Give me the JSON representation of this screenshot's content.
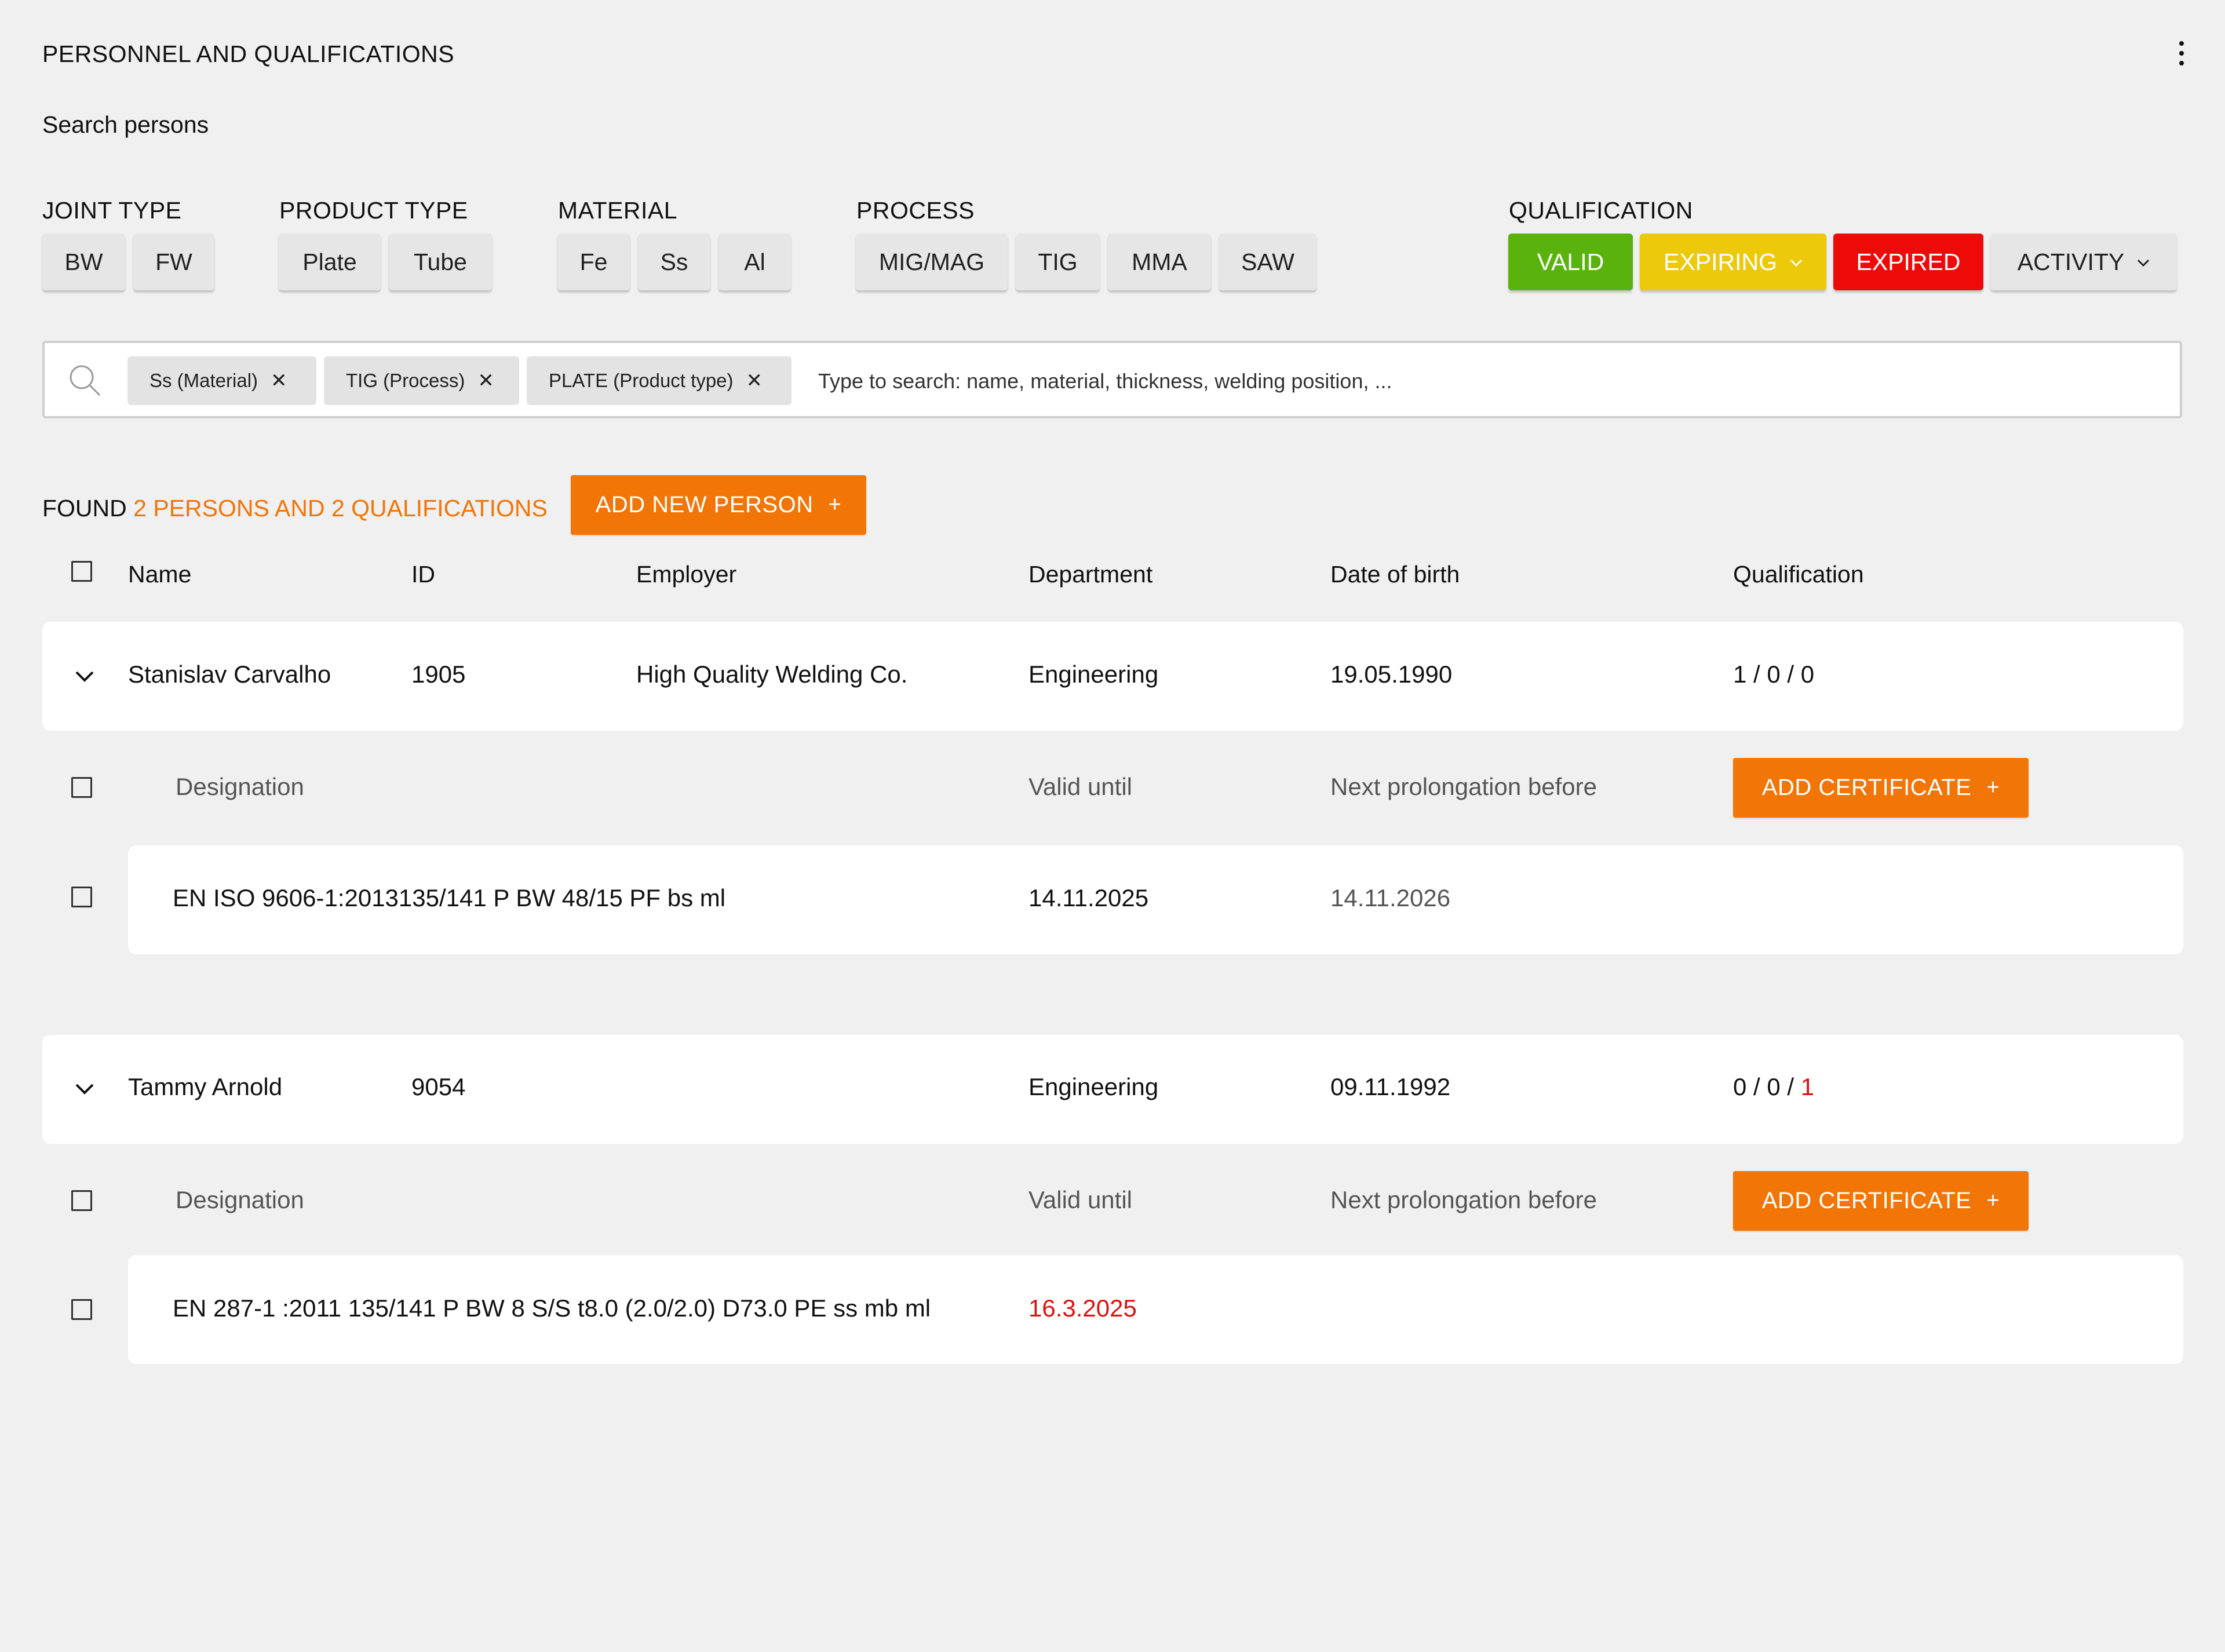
{
  "header": {
    "title": "PERSONNEL AND QUALIFICATIONS",
    "subtitle": "Search persons"
  },
  "filters": {
    "joint_type": {
      "label": "JOINT TYPE",
      "options": [
        "BW",
        "FW"
      ]
    },
    "product_type": {
      "label": "PRODUCT TYPE",
      "options": [
        "Plate",
        "Tube"
      ]
    },
    "material": {
      "label": "MATERIAL",
      "options": [
        "Fe",
        "Ss",
        "Al"
      ]
    },
    "process": {
      "label": "PROCESS",
      "options": [
        "MIG/MAG",
        "TIG",
        "MMA",
        "SAW"
      ]
    },
    "qualification": {
      "label": "QUALIFICATION",
      "valid": "VALID",
      "expiring": "EXPIRING",
      "expired": "EXPIRED",
      "activity": "ACTIVITY"
    }
  },
  "search": {
    "tags": [
      "Ss (Material)",
      "TIG (Process)",
      "PLATE (Product type)"
    ],
    "placeholder": "Type to search: name, material, thickness, welding position, ..."
  },
  "results": {
    "found_label": "FOUND",
    "found_summary": "2 PERSONS AND 2 QUALIFICATIONS",
    "add_person_label": "ADD NEW PERSON"
  },
  "columns": {
    "name": "Name",
    "id": "ID",
    "employer": "Employer",
    "department": "Department",
    "dob": "Date of birth",
    "qualification": "Qualification"
  },
  "cert_columns": {
    "designation": "Designation",
    "valid_until": "Valid until",
    "next_prolongation": "Next prolongation before",
    "add_certificate": "ADD CERTIFICATE"
  },
  "persons": [
    {
      "name": "Stanislav Carvalho",
      "id": "1905",
      "employer": "High Quality Welding Co.",
      "department": "Engineering",
      "dob": "19.05.1990",
      "qual_valid": "1",
      "qual_expiring": "0",
      "qual_expired": "0",
      "certificate": {
        "designation": "EN ISO 9606-1:2013135/141 P BW 48/15 PF bs ml",
        "valid_until": "14.11.2025",
        "next_prolongation": "14.11.2026"
      }
    },
    {
      "name": "Tammy Arnold",
      "id": "9054",
      "employer": "",
      "department": "Engineering",
      "dob": "09.11.1992",
      "qual_valid": "0",
      "qual_expiring": "0",
      "qual_expired": "1",
      "certificate": {
        "designation": "EN 287-1 :2011 135/141 P BW 8 S/S t8.0 (2.0/2.0) D73.0 PE ss mb ml",
        "valid_until": "16.3.2025",
        "next_prolongation": ""
      }
    }
  ],
  "colors": {
    "accent": "#f27507",
    "valid": "#59b30c",
    "expiring": "#ecc90b",
    "expired": "#ef0a0a",
    "background": "#f0f0f0"
  }
}
